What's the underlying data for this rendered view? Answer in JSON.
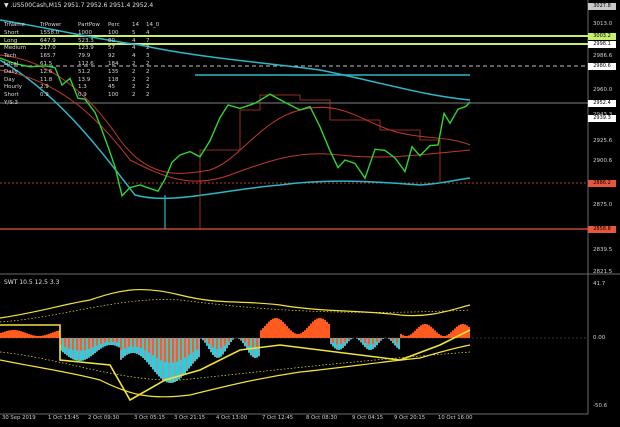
{
  "chart": {
    "title": "▼ .US500Cash,M15  2951.7 2952.6 2951.4 2952.4",
    "indicator_title": "SWT 10.5 12.5 3.3"
  },
  "info_table": {
    "headers": [
      "TrName",
      "TrPower",
      "PartPow",
      "Perc",
      "14",
      "14_0"
    ],
    "rows": [
      [
        "Short",
        "1558.0",
        "1000",
        "100",
        "5",
        "4"
      ],
      [
        "Long",
        "647.9",
        "523.3",
        "80",
        "4",
        "7"
      ],
      [
        "Medium",
        "217.0",
        "123.9",
        "57",
        "4",
        "2"
      ],
      [
        "Tech",
        "165.7",
        "79.9",
        "92",
        "4",
        "3"
      ],
      [
        "Local",
        "61.5",
        "112.6",
        "184",
        "2",
        "2"
      ],
      [
        "Daily",
        "12.6",
        "51.2",
        "135",
        "2",
        "2"
      ],
      [
        "Day",
        "11.8",
        "13.9",
        "118",
        "2",
        "2"
      ],
      [
        "Hourly",
        "2.9",
        "1.3",
        "45",
        "2",
        "2"
      ],
      [
        "Short",
        "0.9",
        "0.9",
        "100",
        "2",
        "2"
      ],
      [
        "Y/S:3",
        "",
        "",
        "",
        "",
        ""
      ]
    ]
  },
  "price_axis": [
    "3027.8",
    "3013.0",
    "3000.2",
    "2986.6",
    "2960.0",
    "2952.4",
    "2943.3",
    "2925.6",
    "2900.6",
    "2886.2",
    "2875.0",
    "2858.8",
    "2839.5",
    "2821.5"
  ],
  "price_tags": [
    {
      "text": "3027.8",
      "color": "#c8c8c8"
    },
    {
      "text": "3003.2",
      "color": "#c6f06a"
    },
    {
      "text": "2998.1",
      "color": "#ffffff"
    },
    {
      "text": "2980.6",
      "color": "#ffffff"
    },
    {
      "text": "2952.4",
      "color": "#ffffff"
    },
    {
      "text": "2939.3",
      "color": "#ffffff"
    },
    {
      "text": "2886.2",
      "color": "#e8573a"
    },
    {
      "text": "2858.8",
      "color": "#e8573a"
    }
  ],
  "indicator_axis": [
    "41.7",
    "0.00",
    "-50.6"
  ],
  "time_axis": [
    "30 Sep 2019",
    "1 Oct 13:45",
    "2 Oct 09:30",
    "3 Oct 05:15",
    "3 Oct 21:15",
    "4 Oct 13:00",
    "7 Oct 12:45",
    "8 Oct 08:30",
    "9 Oct 04:15",
    "9 Oct 20:15",
    "10 Oct 16:00"
  ],
  "colors": {
    "price": "#2fd62f",
    "ma_cyan": "#2bb7c9",
    "ma_red": "#c0392b",
    "level_green": "#c6f06a",
    "level_red": "#e8573a",
    "hist_orange": "#ff5a1f",
    "hist_cyan": "#2ad0d8",
    "hist_gray": "#8aa0b8",
    "yellow": "#f2e33a"
  }
}
